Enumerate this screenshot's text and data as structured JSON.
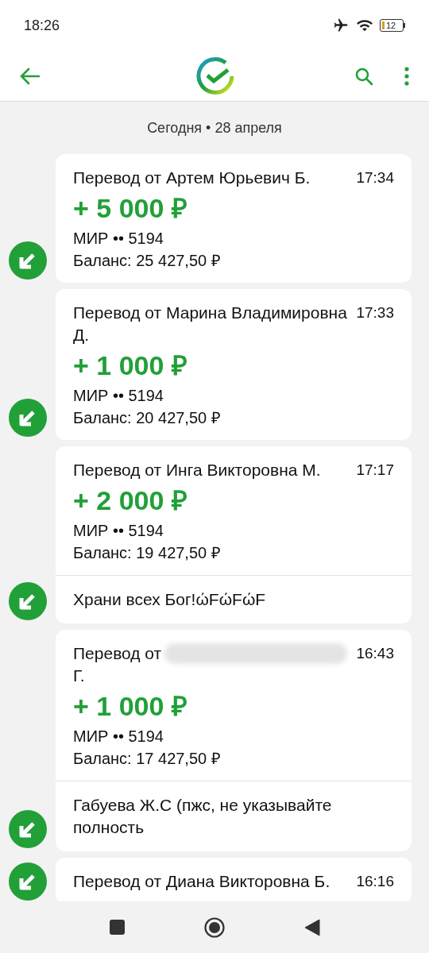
{
  "status_bar": {
    "time": "18:26",
    "battery": "12"
  },
  "date_header": "Сегодня • 28 апреля",
  "transactions": [
    {
      "title": "Перевод от Артем Юрьевич Б.",
      "time": "17:34",
      "amount": "+ 5 000 ₽",
      "card": "МИР •• 5194",
      "balance": "Баланс: 25 427,50 ₽"
    },
    {
      "title": "Перевод от Марина Владимировна Д.",
      "time": "17:33",
      "amount": "+ 1 000 ₽",
      "card": "МИР •• 5194",
      "balance": "Баланс: 20 427,50 ₽"
    },
    {
      "title": "Перевод от Инга Викторовна М.",
      "time": "17:17",
      "amount": "+ 2 000 ₽",
      "card": "МИР •• 5194",
      "balance": "Баланс: 19 427,50 ₽",
      "message": "Храни всех Бог!ώFώFώF"
    },
    {
      "title": "Перевод от",
      "redacted": true,
      "title_end": "Г.",
      "time": "16:43",
      "amount": "+ 1 000 ₽",
      "card": "МИР •• 5194",
      "balance": "Баланс: 17 427,50 ₽",
      "message": "Габуева Ж.С (пжс, не указывайте полность"
    },
    {
      "title": "Перевод от Диана Викторовна Б.",
      "time": "16:16"
    }
  ]
}
